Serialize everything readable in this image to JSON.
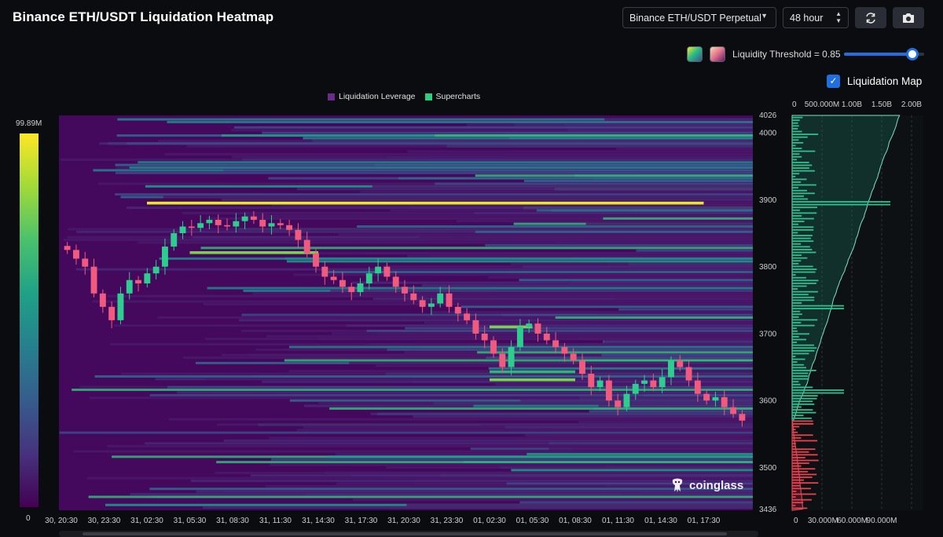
{
  "header": {
    "title": "Binance ETH/USDT Liquidation Heatmap",
    "pair_select": "Binance ETH/USDT Perpetual",
    "range_select": "48 hour"
  },
  "controls": {
    "threshold_label": "Liquidity Threshold = 0.85",
    "threshold_value": 0.85,
    "liquidation_map_label": "Liquidation Map",
    "liquidation_map_checked": true,
    "swatch_colors": [
      "#2bbf87",
      "#e0708a"
    ]
  },
  "legend": {
    "items": [
      {
        "label": "Liquidation Leverage",
        "color": "#6a2c8c"
      },
      {
        "label": "Supercharts",
        "color": "#2bd07f"
      }
    ]
  },
  "colorbar": {
    "max_label": "99.89M",
    "min_label": "0"
  },
  "brand": {
    "logo_text": "coinglass"
  },
  "colors": {
    "background": "#0b0c10",
    "heatmap_base": "#44085c",
    "up_candle": "#2ecc8f",
    "down_candle": "#f05a7e",
    "accent": "#1f6fe0"
  },
  "chart_data": {
    "type": "heatmap",
    "title": "Binance ETH/USDT Liquidation Heatmap",
    "x_tick_labels": [
      "30, 20:30",
      "30, 23:30",
      "31, 02:30",
      "31, 05:30",
      "31, 08:30",
      "31, 11:30",
      "31, 14:30",
      "31, 17:30",
      "31, 20:30",
      "31, 23:30",
      "01, 02:30",
      "01, 05:30",
      "01, 08:30",
      "01, 11:30",
      "01, 14:30",
      "01, 17:30"
    ],
    "y_tick_labels": [
      "4026",
      "4000",
      "3900",
      "3800",
      "3700",
      "3600",
      "3500",
      "3436"
    ],
    "ylim": [
      3436,
      4026
    ],
    "colorbar_range": [
      0,
      99.89
    ],
    "colorbar_unit": "M",
    "price_close_series": [
      3825,
      3812,
      3800,
      3760,
      3740,
      3720,
      3760,
      3780,
      3775,
      3790,
      3800,
      3830,
      3850,
      3860,
      3858,
      3865,
      3870,
      3862,
      3860,
      3868,
      3875,
      3870,
      3860,
      3865,
      3862,
      3855,
      3840,
      3820,
      3800,
      3785,
      3780,
      3770,
      3762,
      3775,
      3790,
      3800,
      3785,
      3770,
      3760,
      3750,
      3740,
      3745,
      3760,
      3740,
      3730,
      3720,
      3700,
      3690,
      3670,
      3650,
      3680,
      3710,
      3715,
      3700,
      3690,
      3680,
      3670,
      3660,
      3640,
      3620,
      3630,
      3600,
      3590,
      3610,
      3625,
      3630,
      3620,
      3635,
      3660,
      3650,
      3630,
      3610,
      3600,
      3605,
      3590,
      3580,
      3570
    ],
    "bright_levels": [
      {
        "price": 3895,
        "from": "31, 02:30",
        "to": "01, 17:30",
        "intensity": "max"
      },
      {
        "price": 3821,
        "from": "31, 05:30",
        "to": "31, 14:30",
        "intensity": "high"
      },
      {
        "price": 3631,
        "from": "01, 02:30",
        "to": "01, 08:30",
        "intensity": "high"
      },
      {
        "price": 3643,
        "from": "01, 02:30",
        "to": "01, 08:30",
        "intensity": "medium"
      },
      {
        "price": 3710,
        "from": "01, 02:30",
        "to": "01, 05:30",
        "intensity": "high"
      }
    ],
    "side_panel": {
      "type": "bar",
      "top_axis_labels": [
        "0",
        "500.000M",
        "1.00B",
        "1.50B",
        "2.00B"
      ],
      "bottom_axis_labels": [
        "0",
        "30.000M",
        "60.000M",
        "90.000M"
      ],
      "top_range": [
        0,
        2000000000
      ],
      "bottom_range": [
        0,
        90000000
      ]
    }
  }
}
